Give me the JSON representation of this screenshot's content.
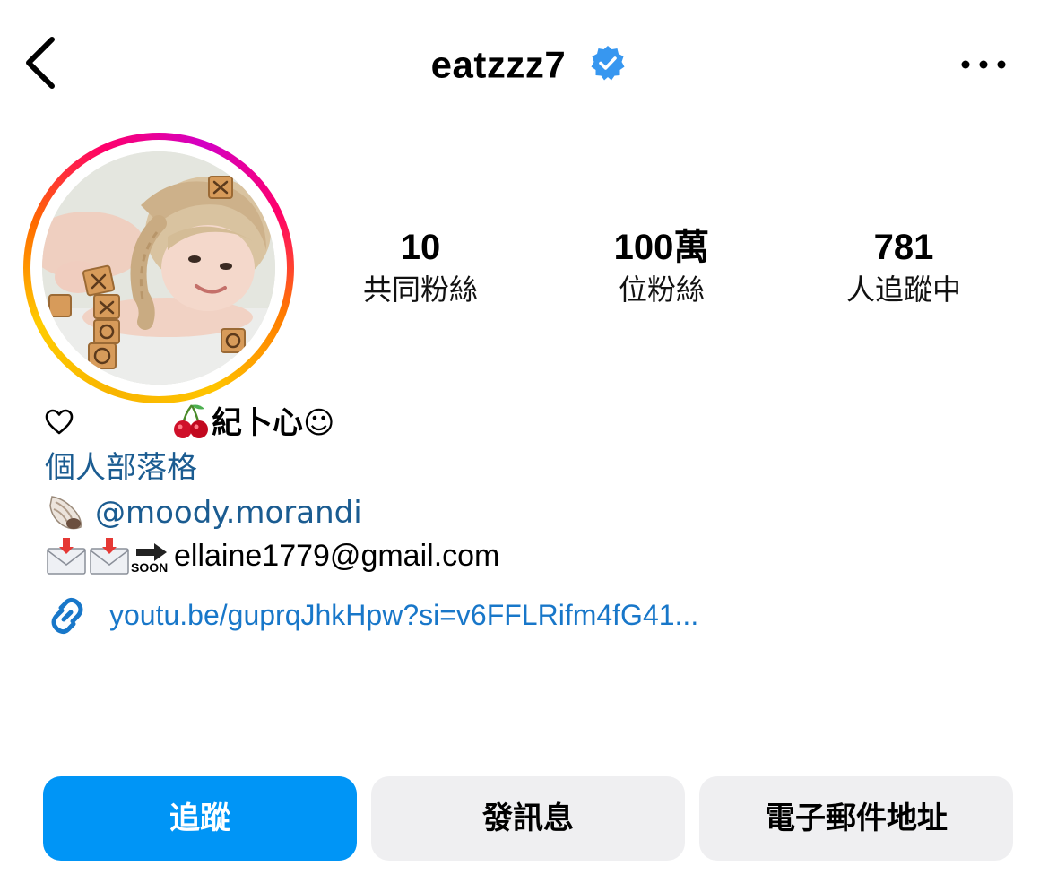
{
  "header": {
    "username": "eatzzz7",
    "verified_icon": "verified-badge-icon",
    "back_icon": "chevron-left-icon",
    "more_icon": "more-horizontal-icon"
  },
  "stats": [
    {
      "value": "10",
      "label": "共同粉絲"
    },
    {
      "value": "100萬",
      "label": "位粉絲"
    },
    {
      "value": "781",
      "label": "人追蹤中"
    }
  ],
  "bio": {
    "name": "紀卜心☺",
    "category": "個人部落格",
    "mention": "@moody.morandi",
    "email_line": "ellaine1779@gmail.com",
    "soon_text": "SOON",
    "link": "youtu.be/guprqJhkHpw?si=v6FFLRifm4fG41..."
  },
  "buttons": {
    "follow": "追蹤",
    "message": "發訊息",
    "email": "電子郵件地址"
  },
  "colors": {
    "primary": "#0095f6",
    "link": "#1877c9",
    "category": "#1b5c91",
    "button_gray": "#efeff1",
    "verified": "#3797f0"
  }
}
